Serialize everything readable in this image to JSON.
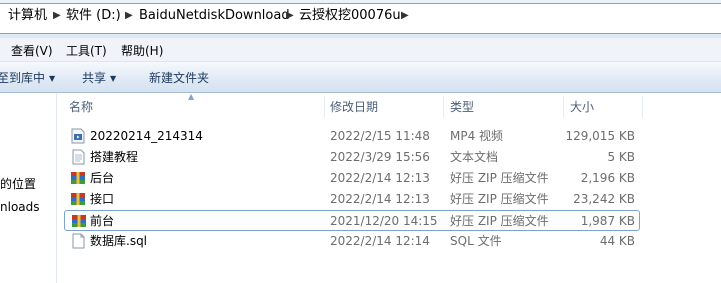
{
  "address": {
    "crumbs": [
      "计算机",
      "软件 (D:)",
      "BaiduNetdiskDownload",
      "云授权挖00076u"
    ],
    "separator": "▶"
  },
  "menu": {
    "view": "查看(V)",
    "tools": "工具(T)",
    "help": "帮助(H)"
  },
  "toolbar": {
    "include_library": "至到库中",
    "share": "共享",
    "new_folder": "新建文件夹"
  },
  "nav": {
    "items": [
      "的位置",
      "nloads"
    ]
  },
  "columns": {
    "name": "名称",
    "modified": "修改日期",
    "type": "类型",
    "size": "大小"
  },
  "files": [
    {
      "name": "20220214_214314",
      "modified": "2022/2/15 11:48",
      "type": "MP4 视频",
      "size": "129,015 KB",
      "icon": "video-file-icon"
    },
    {
      "name": "搭建教程",
      "modified": "2022/3/29 15:56",
      "type": "文本文档",
      "size": "5 KB",
      "icon": "text-file-icon"
    },
    {
      "name": "后台",
      "modified": "2022/2/14 12:13",
      "type": "好压 ZIP 压缩文件",
      "size": "2,196 KB",
      "icon": "zip-archive-icon"
    },
    {
      "name": "接口",
      "modified": "2022/2/14 12:13",
      "type": "好压 ZIP 压缩文件",
      "size": "23,242 KB",
      "icon": "zip-archive-icon"
    },
    {
      "name": "前台",
      "modified": "2021/12/20 14:15",
      "type": "好压 ZIP 压缩文件",
      "size": "1,987 KB",
      "icon": "zip-archive-icon",
      "selected": true
    },
    {
      "name": "数据库.sql",
      "modified": "2022/2/14 12:14",
      "type": "SQL 文件",
      "size": "44 KB",
      "icon": "sql-file-icon"
    }
  ],
  "colors": {
    "selection_border": "#7da2ce",
    "header_text": "#4c607a",
    "meta_text": "#6d6d6d"
  }
}
